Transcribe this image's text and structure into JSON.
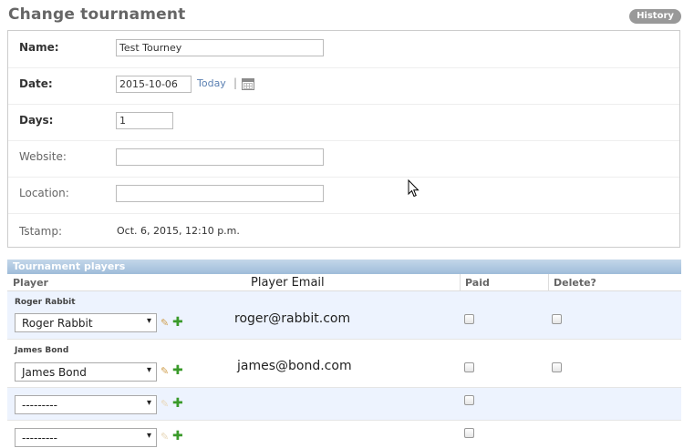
{
  "page": {
    "title": "Change tournament",
    "history_label": "History"
  },
  "form": {
    "name": {
      "label": "Name:",
      "value": "Test Tourney"
    },
    "date": {
      "label": "Date:",
      "value": "2015-10-06",
      "today_label": "Today",
      "separator": "|"
    },
    "days": {
      "label": "Days:",
      "value": "1"
    },
    "website": {
      "label": "Website:",
      "value": ""
    },
    "location": {
      "label": "Location:",
      "value": ""
    },
    "tstamp": {
      "label": "Tstamp:",
      "value": "Oct. 6, 2015, 12:10 p.m."
    }
  },
  "inline": {
    "title": "Tournament players",
    "columns": {
      "player": "Player",
      "email": "Player Email",
      "paid": "Paid",
      "delete": "Delete?"
    },
    "rows": [
      {
        "name": "Roger Rabbit",
        "select": "Roger Rabbit",
        "email": "roger@rabbit.com",
        "paid": false,
        "delete": false
      },
      {
        "name": "James Bond",
        "select": "James Bond",
        "email": "james@bond.com",
        "paid": false,
        "delete": false
      },
      {
        "name": "",
        "select": "---------",
        "email": "",
        "paid": false
      },
      {
        "name": "",
        "select": "---------",
        "email": "",
        "paid": false
      }
    ]
  },
  "icons": {
    "dropdown": "▾",
    "edit": "✎",
    "add": "✚"
  },
  "colors": {
    "link": "#5b80b2",
    "inline_header": "#9fbcd9",
    "shaded_row": "#edf3fe",
    "add_icon": "#3a9a2a"
  }
}
